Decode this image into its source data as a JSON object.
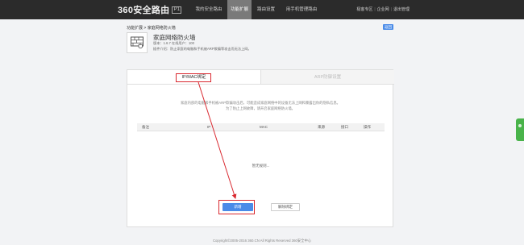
{
  "topbar": {
    "logo_text": "360安全路由",
    "logo_badge": "P1",
    "nav": [
      {
        "label": "我的安全路由",
        "active": false
      },
      {
        "label": "功能扩展",
        "active": true
      },
      {
        "label": "路由设置",
        "active": false
      },
      {
        "label": "用手机管理路由",
        "active": false
      }
    ],
    "links": [
      "极客专区",
      "企业网",
      "退出管理"
    ]
  },
  "breadcrumb": "功能扩展 > 家庭网络防火墙",
  "back_button": "返回",
  "app": {
    "icon": "firewall-icon",
    "title": "家庭网络防火墙",
    "meta": "版本：1.6.7    在线用户：100",
    "desc": "插件介绍：防止家庭的电脑和手机被ARP欺骗等攻击而无法上网。"
  },
  "tabs": {
    "ip_mac": "IP/MAC绑定",
    "mac_filter": "ARP防御设置"
  },
  "intro": [
    "家庭内部的电脑和手机被ARP欺骗攻击后，可能造成家庭网络中的设备无法上网和暴露出你的隐私信息。",
    "为了防止上网故障，请开启家庭网络防火墙。"
  ],
  "table": {
    "columns": [
      "备注",
      "IP",
      "MAC",
      "来源",
      "接口",
      "操作"
    ],
    "empty_text": "暂无规则..."
  },
  "buttons": {
    "add": "新增",
    "unbind": "解除绑定"
  },
  "footer": "Copyright©2005-2016 360.CN All Rights Reserved 360安全中心",
  "colors": {
    "topbar_bg": "#2b2b2b",
    "accent": "#4a8be8",
    "annotation": "#d9282f",
    "side_widget": "#49b34a"
  }
}
